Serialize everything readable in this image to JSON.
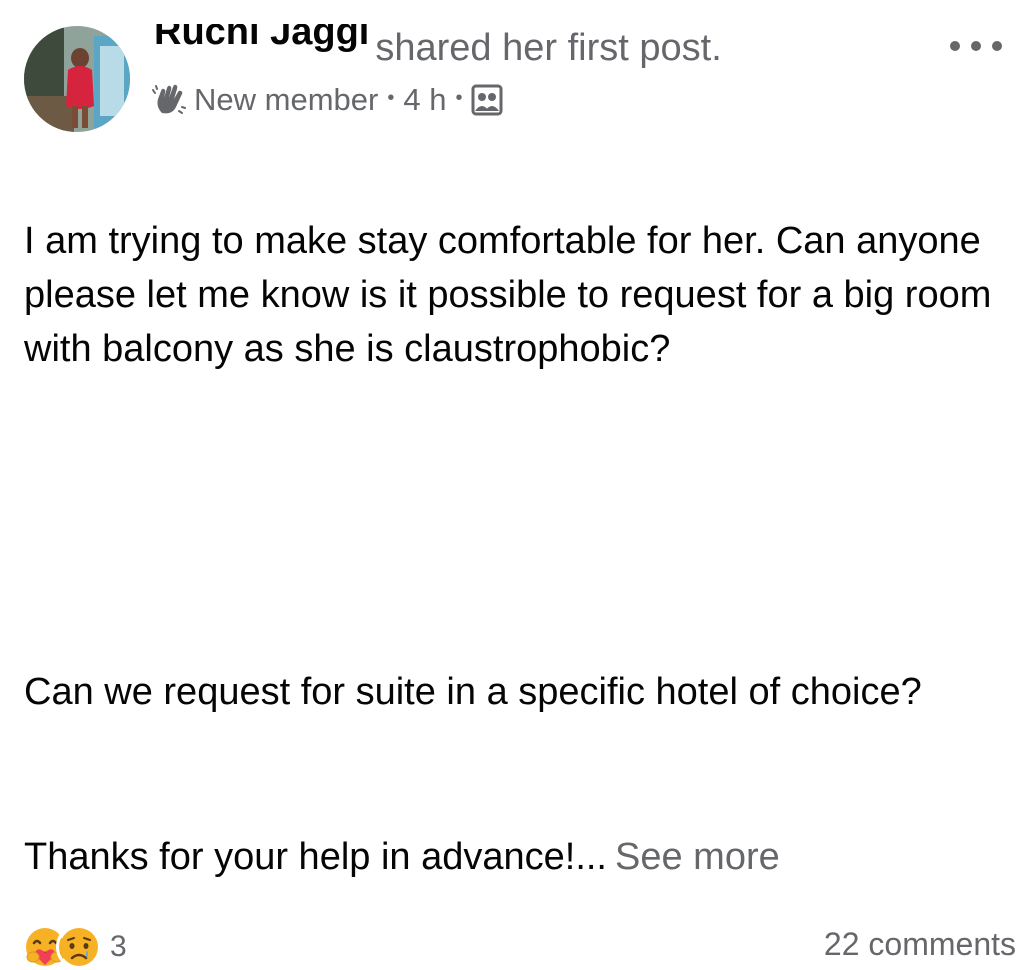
{
  "post": {
    "author": {
      "name": "Ruchi Jaggi",
      "action": "shared her first post."
    },
    "meta": {
      "badge_icon": "wave-icon",
      "badge": "New member",
      "separator": "•",
      "time": "4 h",
      "audience_icon": "group-icon"
    },
    "menu_icon": "more-dots-icon",
    "paragraphs": [
      "I am trying to make stay comfortable for her. Can anyone please let me know is it possible to request for a big room with balcony as she is claustrophobic?",
      "Can we request for suite in a specific hotel of choice?",
      "Thanks for your help in advance!..."
    ],
    "see_more": "See more",
    "reactions": {
      "icons": [
        "care-emoji-icon",
        "sad-emoji-icon"
      ],
      "count": "3"
    },
    "comments": "22 comments"
  },
  "colors": {
    "primary_text": "#050505",
    "secondary_text": "#65676b",
    "reaction_yellow": "#f7b125"
  }
}
